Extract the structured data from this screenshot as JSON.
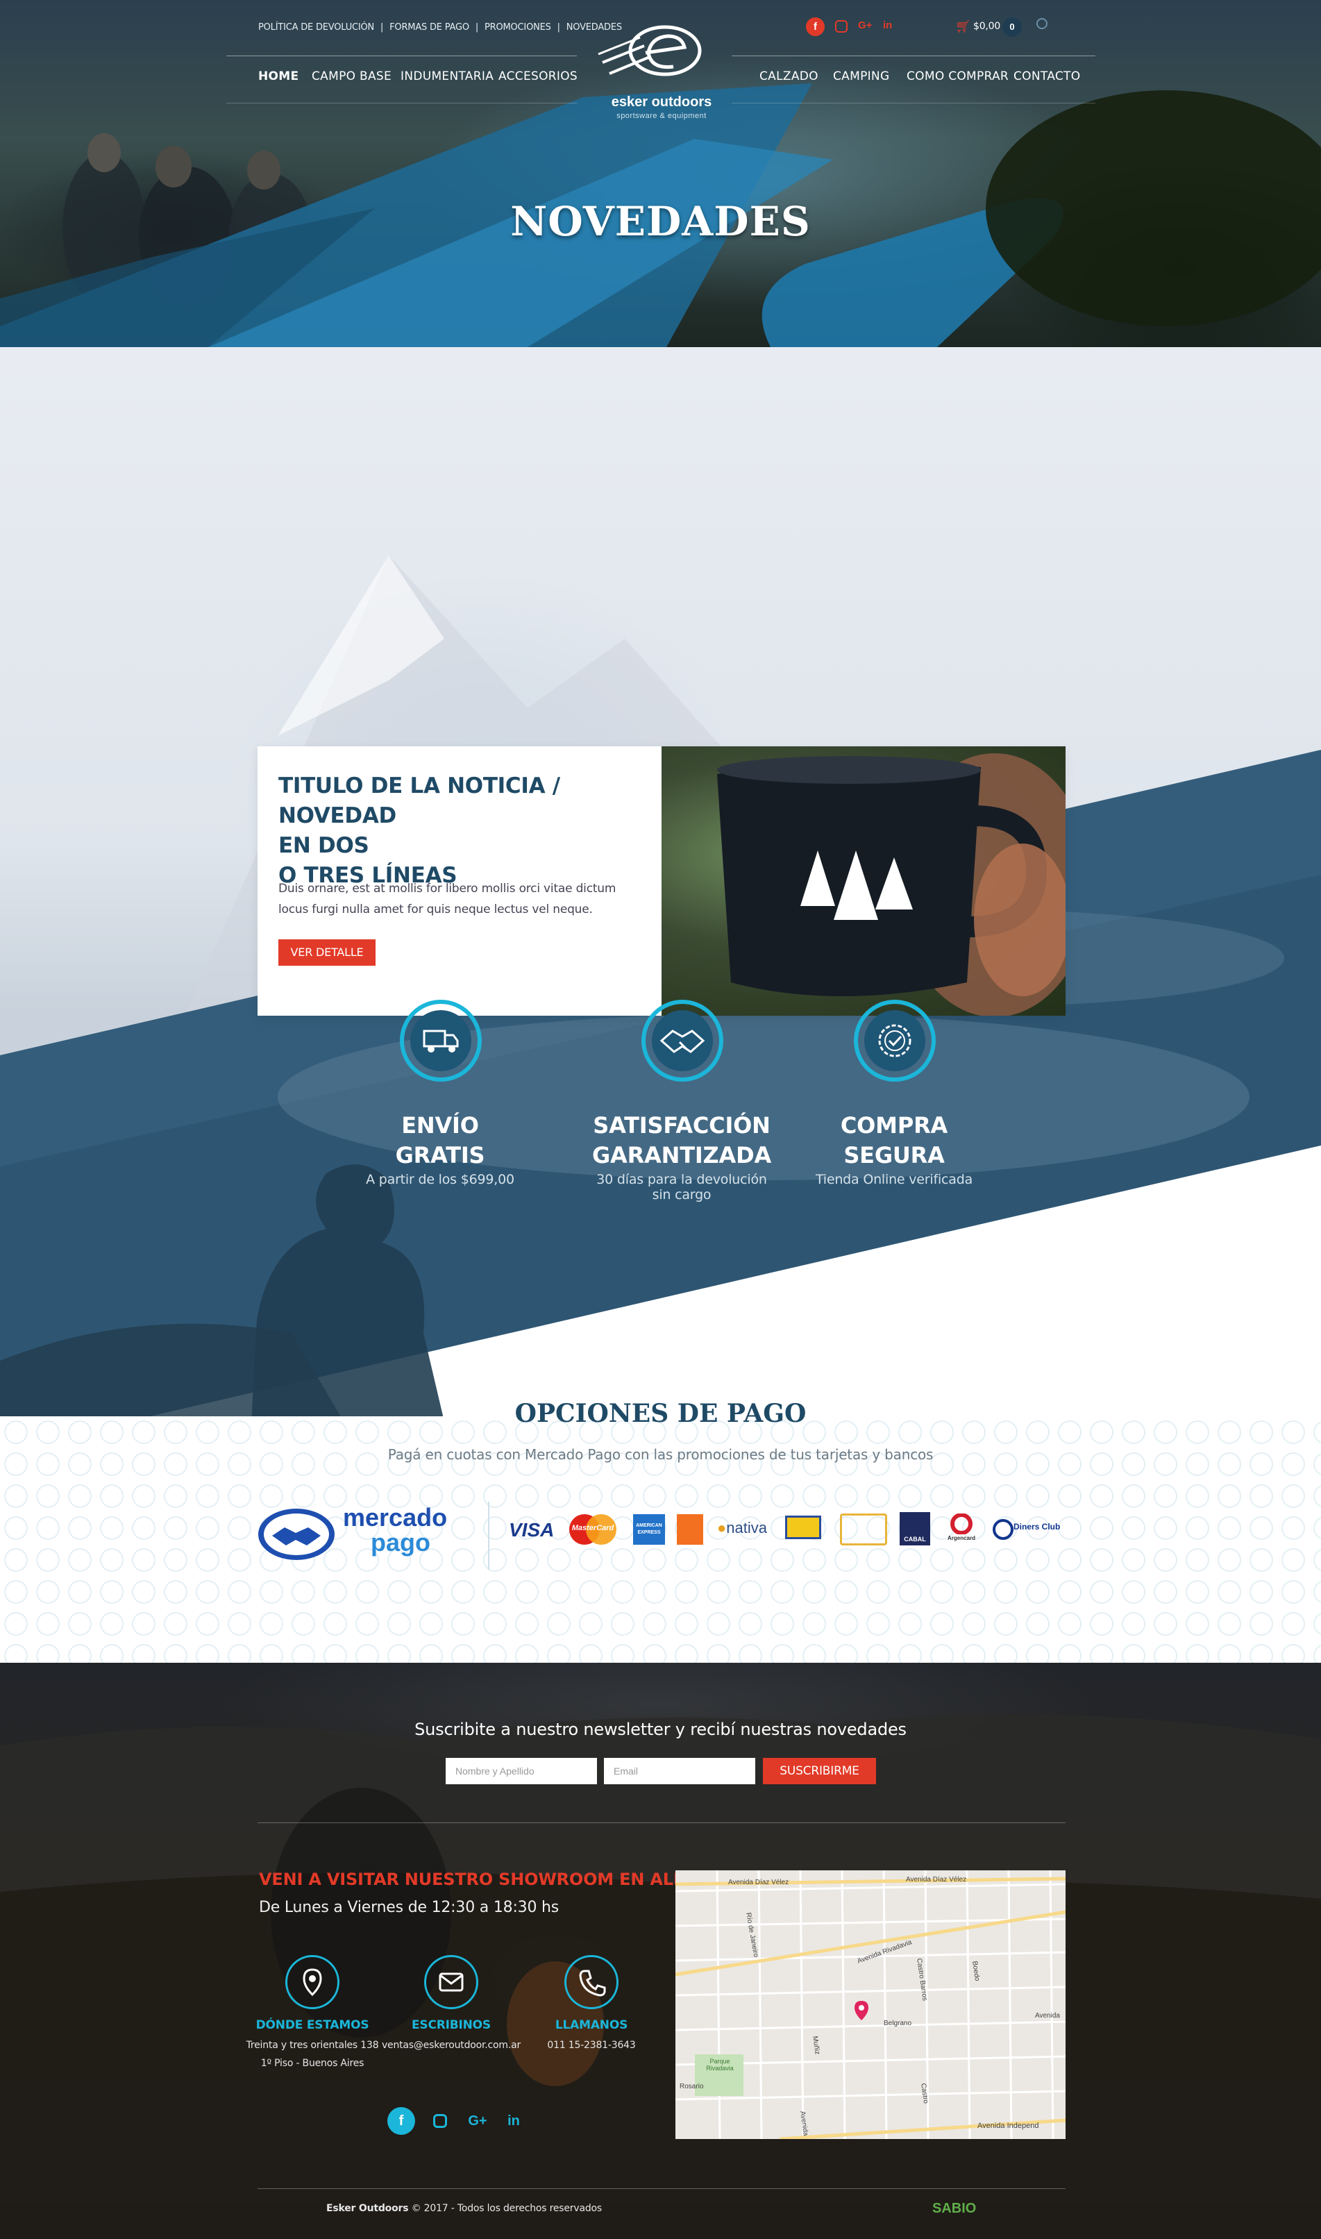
{
  "topbar": {
    "links": [
      "POLÍTICA DE DEVOLUCIÓN",
      "FORMAS DE PAGO",
      "PROMOCIONES",
      "NOVEDADES"
    ],
    "separator": "|",
    "cart_total": "$0,00",
    "cart_count": "0"
  },
  "brand": {
    "name": "esker outdoors",
    "tagline": "sportsware & equipment"
  },
  "nav": {
    "left": [
      "HOME",
      "CAMPO BASE",
      "INDUMENTARIA",
      "ACCESORIOS"
    ],
    "right": [
      "CALZADO",
      "CAMPING",
      "COMO COMPRAR",
      "CONTACTO"
    ]
  },
  "hero": {
    "title": "NOVEDADES"
  },
  "news": {
    "title_lines": [
      "TITULO DE LA NOTICIA / NOVEDAD",
      "EN DOS",
      "O TRES LÍNEAS"
    ],
    "body": "Duis ornare, est at mollis for libero mollis orci vitae dictum locus furgi nulla amet for quis neque lectus vel neque.",
    "button": "VER DETALLE"
  },
  "features": [
    {
      "icon": "truck-icon",
      "title_1": "ENVÍO",
      "title_2": "GRATIS",
      "subtitle": "A partir de los $699,00"
    },
    {
      "icon": "handshake-icon",
      "title_1": "SATISFACCIÓN",
      "title_2": "GARANTIZADA",
      "subtitle": "30 días para la devolución sin cargo"
    },
    {
      "icon": "badge-check-icon",
      "title_1": "COMPRA",
      "title_2": "SEGURA",
      "subtitle": "Tienda Online verificada"
    }
  ],
  "payment": {
    "title": "OPCIONES DE PAGO",
    "subtitle": "Pagá en cuotas con Mercado Pago con las promociones de tus tarjetas y bancos",
    "mp_line1": "mercado",
    "mp_line2": "pago",
    "cards": [
      "VISA",
      "MasterCard",
      "AMERICAN EXPRESS",
      "nativa",
      "CABAL",
      "Argencard",
      "Diners Club"
    ]
  },
  "newsletter": {
    "heading": "Suscribite a nuestro newsletter y recibí nuestras novedades",
    "name_placeholder": "Nombre y Apellido",
    "email_placeholder": "Email",
    "button": "SUSCRIBIRME"
  },
  "showroom": {
    "heading": "VENI A VISITAR NUESTRO SHOWROOM EN ALMAGRO",
    "hours": "De Lunes a Viernes de 12:30 a 18:30 hs"
  },
  "contacts": [
    {
      "label": "DÓNDE ESTAMOS",
      "line1": "Treinta y tres orientales 138",
      "line2": "1º Piso - Buenos Aires"
    },
    {
      "label": "ESCRIBINOS",
      "line1": "ventas@eskeroutdoor.com.ar",
      "line2": ""
    },
    {
      "label": "LLAMANOS",
      "line1": "011 15-2381-3643",
      "line2": ""
    }
  ],
  "map": {
    "streets": [
      "Avenida Díaz Vélez",
      "Avenida Díaz Vélez",
      "Río de Janeiro",
      "Avenida Rivadavia",
      "Castro Barros",
      "Boedo",
      "Belgrano",
      "Avenida",
      "Muñiz",
      "Castro",
      "Rosario",
      "Parque Rivadavia",
      "Avenida",
      "Avenida Independ"
    ]
  },
  "footer": {
    "copyright_brand": "Esker Outdoors",
    "copyright_rest": " © 2017 - Todos los derechos reservados",
    "credit": "SABIO"
  },
  "colors": {
    "accent": "#1bb6d9",
    "brand_blue": "#1f4a66",
    "cta_red": "#e23a28"
  }
}
